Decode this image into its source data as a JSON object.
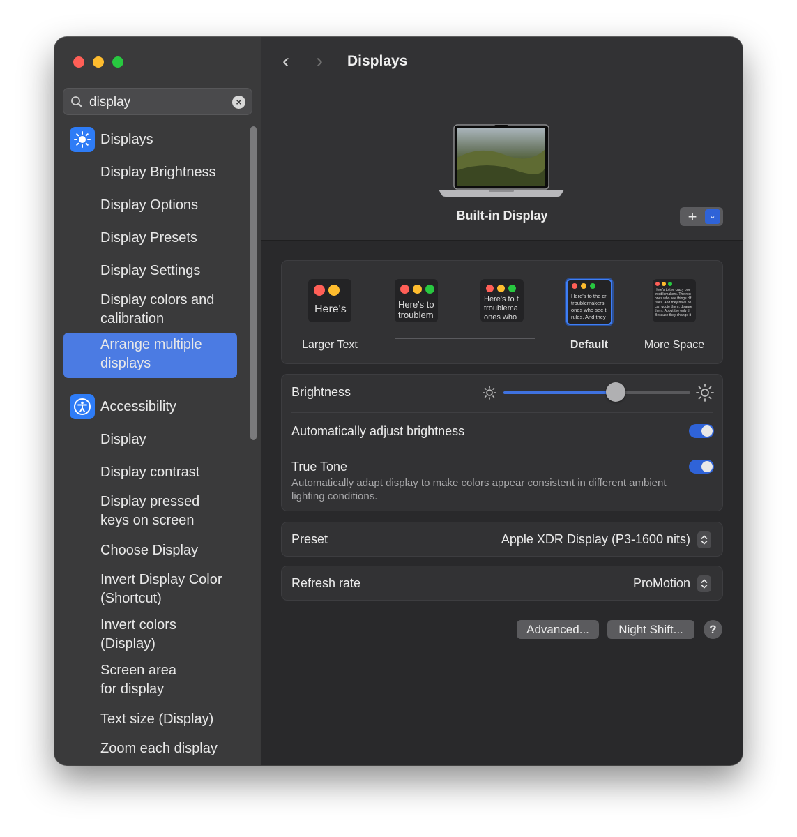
{
  "window": {
    "title": "Displays"
  },
  "search": {
    "value": "display"
  },
  "sidebar": {
    "displays_label": "Displays",
    "displays_items": [
      "Display Brightness",
      "Display Options",
      "Display Presets",
      "Display Settings"
    ],
    "display_colors": [
      "Display colors and",
      "calibration"
    ],
    "selected": [
      "Arrange multiple",
      "displays"
    ],
    "accessibility_label": "Accessibility",
    "a_display": "Display",
    "a_contrast": "Display contrast",
    "a_pressed": [
      "Display pressed",
      "keys on screen"
    ],
    "a_choose": "Choose Display",
    "a_invert_color": [
      "Invert Display Color",
      "(Shortcut)"
    ],
    "a_invert": [
      "Invert colors",
      "(Display)"
    ],
    "a_screen": [
      "Screen area",
      "for display"
    ],
    "a_text": "Text size (Display)",
    "a_zoom": "Zoom each display"
  },
  "header": {
    "title": "Displays",
    "display_name": "Built-in Display",
    "add_label": "+"
  },
  "resolutions": {
    "larger_label": "Larger Text",
    "default_label": "Default",
    "more_label": "More Space",
    "t1": "Here's",
    "t2": [
      "Here's to",
      "troublem"
    ],
    "t3": [
      "Here's to t",
      "troublema",
      "ones who"
    ],
    "t4": [
      "Here's to the cr",
      "troublemakers.",
      "ones who see t",
      "rules. And they"
    ],
    "t5": [
      "Here's to the crazy one",
      "troublemakers. The rou",
      "ones who see things dif",
      "rules. And they have no",
      "can quote them, disagre",
      "them. About the only th",
      "Because they change it"
    ]
  },
  "brightness": {
    "label": "Brightness",
    "level_percent": 60,
    "auto_label": "Automatically adjust brightness",
    "auto_enabled": true,
    "truetone_label": "True Tone",
    "truetone_enabled": true,
    "truetone_desc": "Automatically adapt display to make colors appear consistent in different ambient lighting conditions."
  },
  "preset": {
    "label": "Preset",
    "value": "Apple XDR Display (P3-1600 nits)"
  },
  "refresh": {
    "label": "Refresh rate",
    "value": "ProMotion"
  },
  "buttons": {
    "advanced": "Advanced...",
    "night_shift": "Night Shift...",
    "help": "?"
  },
  "colors": {
    "accent": "#2f63d8",
    "selection": "#4b7be3",
    "sidebar_bg": "#3a3a3b",
    "main_bg": "#29292b"
  },
  "icons": [
    "search-icon",
    "clear-icon",
    "displays-sun-icon",
    "accessibility-icon",
    "back-chevron-icon",
    "forward-chevron-icon",
    "laptop-icon",
    "sun-small-icon",
    "sun-large-icon",
    "stepper-icon"
  ]
}
